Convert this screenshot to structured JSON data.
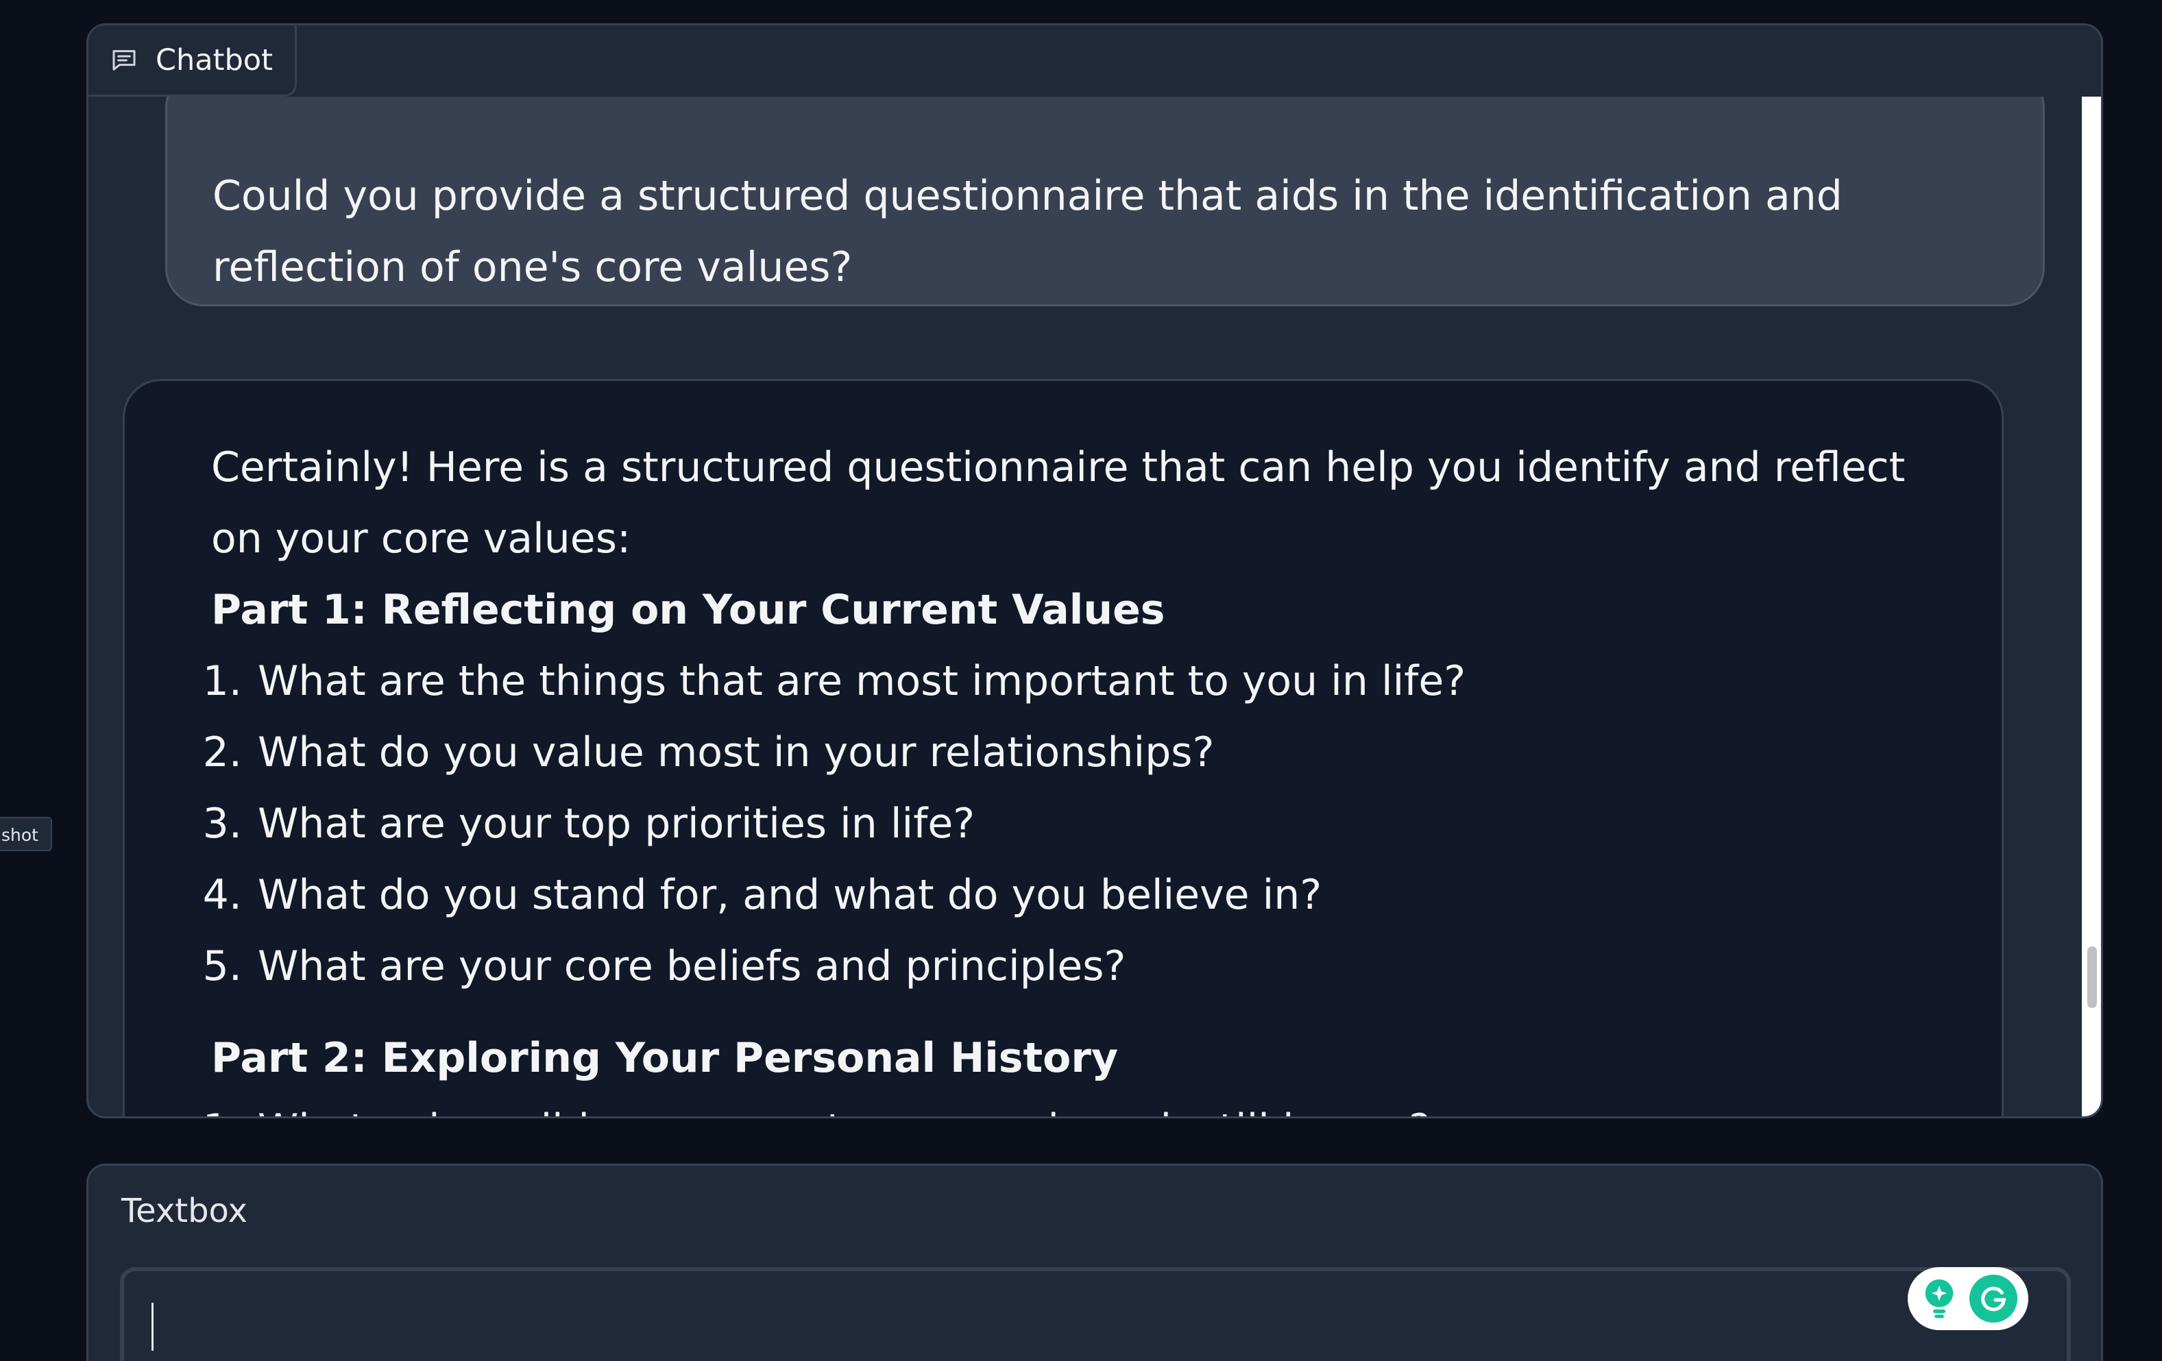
{
  "side_tag": {
    "text": "shot"
  },
  "chatbot": {
    "label": "Chatbot",
    "icon": "chat-bubble-icon",
    "user_message": "Could you provide a structured questionnaire that aids in the identification and reflection of one's core values?",
    "bot_message": {
      "intro": "Certainly! Here is a structured questionnaire that can help you identify and reflect on your core values:",
      "parts": [
        {
          "title": "Part 1: Reflecting on Your Current Values",
          "questions": [
            "What are the things that are most important to you in life?",
            "What do you value most in your relationships?",
            "What are your top priorities in life?",
            "What do you stand for, and what do you believe in?",
            "What are your core beliefs and principles?"
          ]
        },
        {
          "title": "Part 2: Exploring Your Personal History",
          "questions": [
            "What values did your parents or caregivers instill in you?"
          ]
        }
      ]
    }
  },
  "textbox": {
    "label": "Textbox",
    "value": "",
    "assistant_icons": [
      "lightbulb-icon",
      "grammarly-g-icon"
    ]
  },
  "colors": {
    "page_bg": "#0b0f19",
    "panel_bg": "#1f2937",
    "user_bubble": "#374151",
    "bot_bubble": "#111827",
    "grammarly_green": "#15c39a"
  }
}
